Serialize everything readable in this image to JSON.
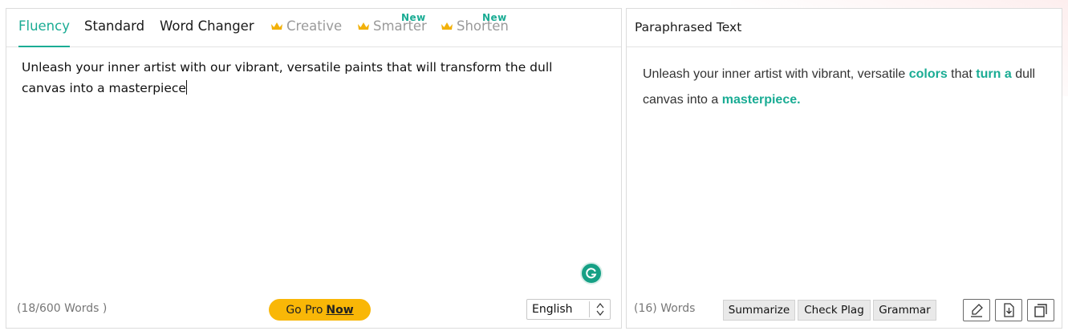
{
  "tabs": [
    {
      "label": "Fluency"
    },
    {
      "label": "Standard"
    },
    {
      "label": "Word Changer"
    },
    {
      "label": "Creative"
    },
    {
      "label": "Smarter",
      "badge": "New"
    },
    {
      "label": "Shorten",
      "badge": "New"
    }
  ],
  "input": {
    "text": "Unleash your inner artist with our vibrant, versatile paints that will transform the dull canvas into a masterpiece",
    "word_count": "(18/600 Words )"
  },
  "gopro": {
    "prefix": "Go Pro",
    "emphasis": "Now"
  },
  "language": {
    "selected": "English"
  },
  "output": {
    "title": "Paraphrased Text",
    "segments": [
      {
        "text": "Unleash your inner artist with vibrant, versatile ",
        "changed": false
      },
      {
        "text": "colors",
        "changed": true
      },
      {
        "text": " that ",
        "changed": false
      },
      {
        "text": "turn a",
        "changed": true
      },
      {
        "text": " dull canvas into a ",
        "changed": false
      },
      {
        "text": "masterpiece.",
        "changed": true
      }
    ],
    "word_count": "(16) Words"
  },
  "actions": {
    "summarize": "Summarize",
    "check_plag": "Check Plag",
    "grammar": "Grammar"
  },
  "icons": {
    "grammarly": "grammarly-icon",
    "highlight": "highlighter-icon",
    "download": "download-icon",
    "copy": "copy-icon"
  },
  "colors": {
    "accent": "#1aac94",
    "gopro": "#f9b707",
    "crown": "#f2b10a"
  }
}
